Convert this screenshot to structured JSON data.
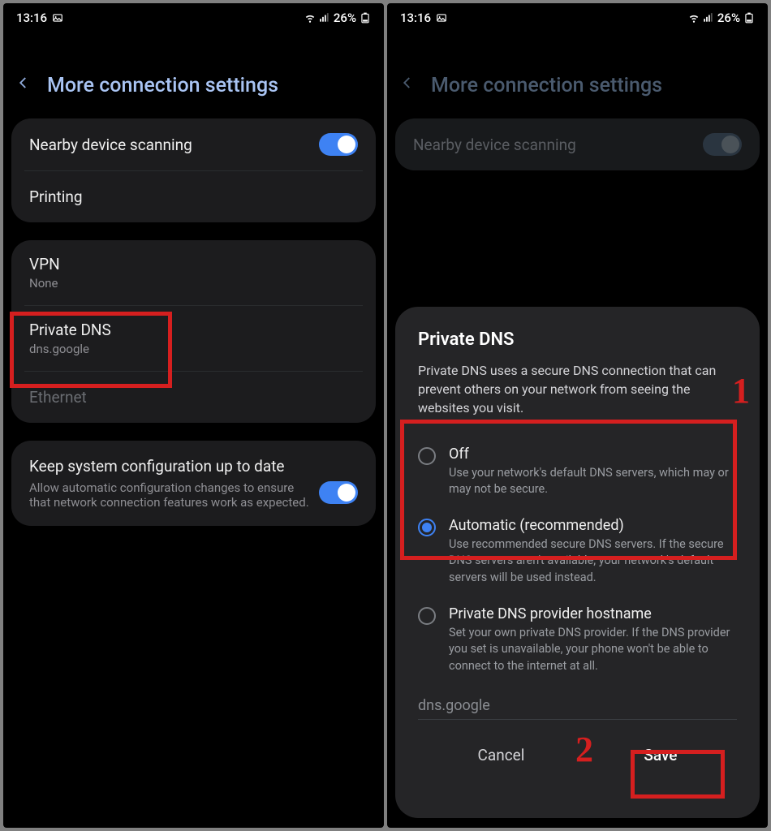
{
  "status": {
    "time": "13:16",
    "battery": "26%"
  },
  "header": {
    "title": "More connection settings"
  },
  "left": {
    "nearby": {
      "label": "Nearby device scanning"
    },
    "printing": {
      "label": "Printing"
    },
    "vpn": {
      "label": "VPN",
      "sub": "None"
    },
    "private_dns": {
      "label": "Private DNS",
      "sub": "dns.google"
    },
    "ethernet": {
      "label": "Ethernet"
    },
    "keep_config": {
      "label": "Keep system configuration up to date",
      "sub": "Allow automatic configuration changes to ensure that network connection features work as expected."
    }
  },
  "dialog": {
    "title": "Private DNS",
    "desc": "Private DNS uses a secure DNS connection that can prevent others on your network from seeing the websites you visit.",
    "off": {
      "label": "Off",
      "sub": "Use your network's default DNS servers, which may or may not be secure."
    },
    "auto": {
      "label": "Automatic (recommended)",
      "sub": "Use recommended secure DNS servers. If the secure DNS servers aren't available, your network's default servers will be used instead."
    },
    "hostname": {
      "label": "Private DNS provider hostname",
      "sub": "Set your own private DNS provider. If the DNS provider you set is unavailable, your phone won't be able to connect to the internet at all."
    },
    "input_value": "dns.google",
    "cancel": "Cancel",
    "save": "Save"
  },
  "annotations": {
    "n1": "1",
    "n2": "2"
  }
}
